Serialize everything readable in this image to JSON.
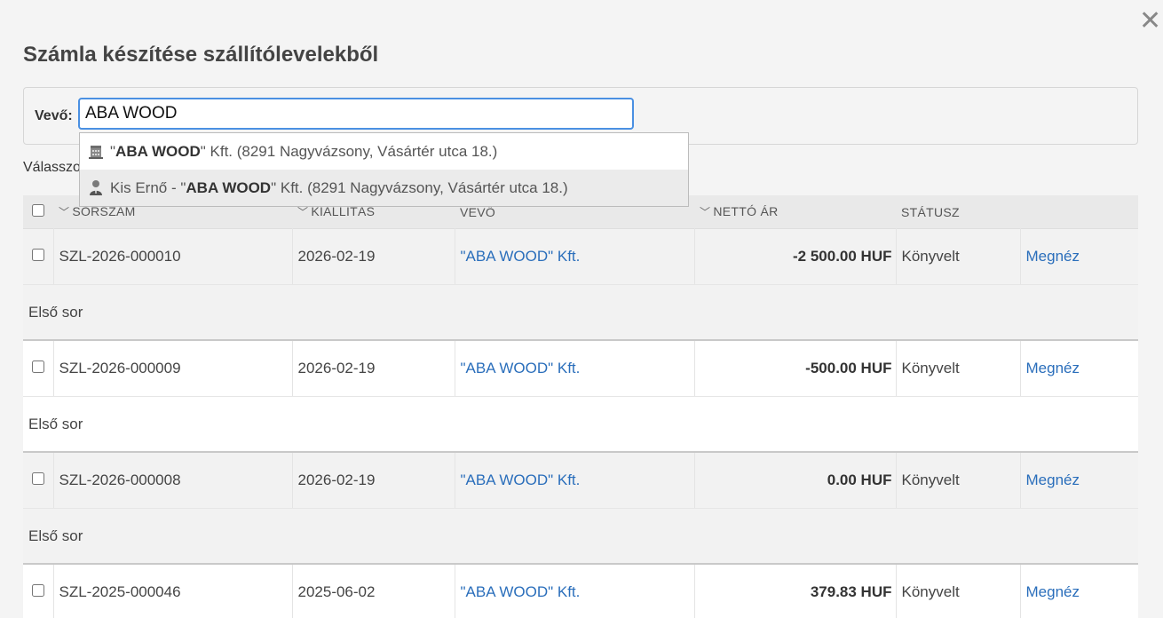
{
  "dialog": {
    "title": "Számla készítése szállítólevelekből",
    "close_glyph": "✕"
  },
  "filter": {
    "label": "Vevő:",
    "input_value": "ABA WOOD",
    "behind_text": "Válasszo"
  },
  "autocomplete": [
    {
      "icon": "building-icon",
      "prefix": "\"",
      "bold": "ABA WOOD",
      "suffix": "\" Kft. (8291 Nagyvázsony, Vásártér utca 18.)"
    },
    {
      "icon": "person-icon",
      "prefix": "Kis Ernő - \"",
      "bold": "ABA WOOD",
      "suffix": "\" Kft. (8291 Nagyvázsony, Vásártér utca 18.)"
    }
  ],
  "table": {
    "columns": {
      "number": "SORSZÁM",
      "issued": "KIÁLLÍTÁS",
      "buyer": "VEVŐ",
      "net": "NETTÓ ÁR",
      "status": "STÁTUSZ"
    },
    "rows": [
      {
        "number": "SZL-2026-000010",
        "issued": "2026-02-19",
        "buyer": "\"ABA WOOD\" Kft.",
        "net": "-2 500.00 HUF",
        "status": "Könyvelt",
        "action": "Megnéz",
        "sub": "Első sor"
      },
      {
        "number": "SZL-2026-000009",
        "issued": "2026-02-19",
        "buyer": "\"ABA WOOD\" Kft.",
        "net": "-500.00 HUF",
        "status": "Könyvelt",
        "action": "Megnéz",
        "sub": "Első sor"
      },
      {
        "number": "SZL-2026-000008",
        "issued": "2026-02-19",
        "buyer": "\"ABA WOOD\" Kft.",
        "net": "0.00 HUF",
        "status": "Könyvelt",
        "action": "Megnéz",
        "sub": "Első sor"
      },
      {
        "number": "SZL-2025-000046",
        "issued": "2025-06-02",
        "buyer": "\"ABA WOOD\" Kft.",
        "net": "379.83 HUF",
        "status": "Könyvelt",
        "action": "Megnéz",
        "sub": ""
      }
    ]
  },
  "colors": {
    "accent": "#4a90e2",
    "link": "#2a6ebb"
  }
}
